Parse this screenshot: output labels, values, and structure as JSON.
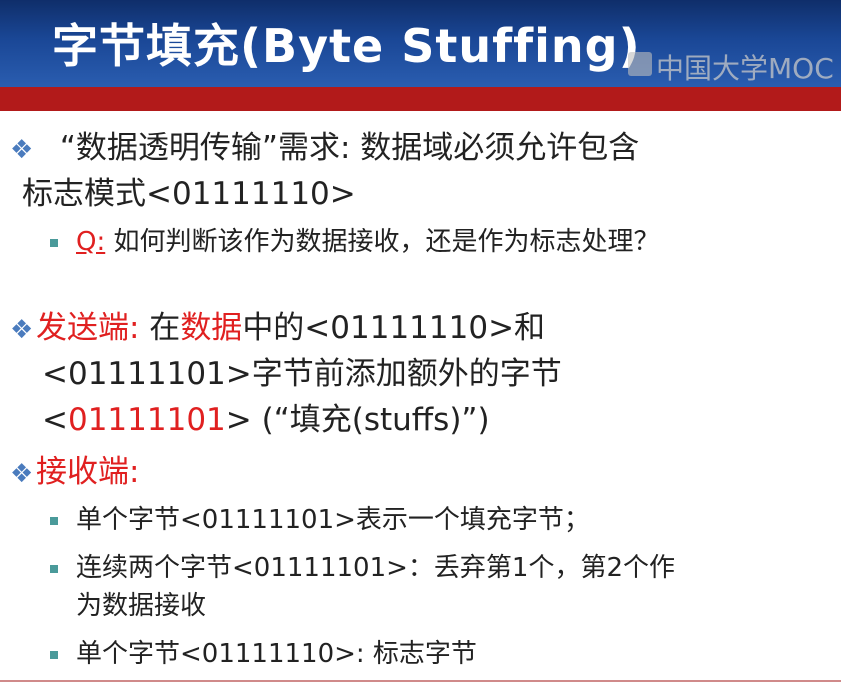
{
  "title": "字节填充(Byte Stuffing)",
  "watermark": "中国大学MOC",
  "block1": {
    "line1": "“数据透明传输”需求: 数据域必须允许包含",
    "line2": "标志模式<01111110>",
    "q_label": "Q:",
    "q_text": " 如何判断该作为数据接收，还是作为标志处理？"
  },
  "sender": {
    "label": "发送端:",
    "t1": " 在",
    "t2": "数据",
    "t3": "中的<01111110>和",
    "line2": "<01111101>字节前添加额外的字节",
    "l3_a": "<",
    "l3_b": "01111101",
    "l3_c": "> (“填充(stuffs)”)"
  },
  "receiver": {
    "label": "接收端:",
    "items": [
      "单个字节<01111101>表示一个填充字节；",
      "连续两个字节<01111101>：丢弃第1个，第2个作",
      "为数据接收",
      "单个字节<01111110>: 标志字节"
    ]
  },
  "colors": {
    "title_bg": "#1a4796",
    "red_bar": "#b21a1a",
    "highlight": "#e02020",
    "bullet_diamond": "#4a7bbd",
    "bullet_square": "#4a9a9a"
  },
  "icons": {
    "main_bullet": "diamond-bullet-icon",
    "sub_bullet": "square-bullet-icon"
  }
}
